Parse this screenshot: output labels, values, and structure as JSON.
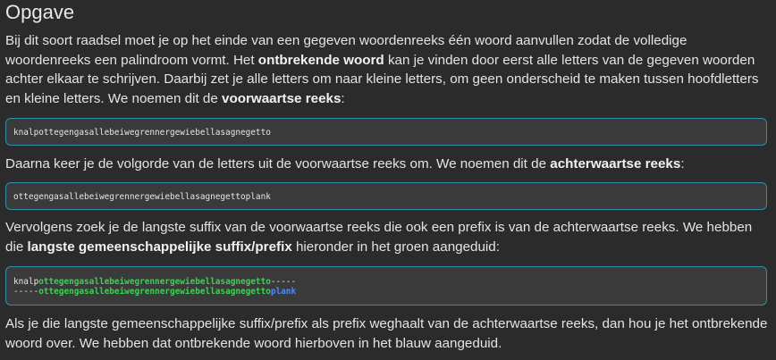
{
  "heading": "Opgave",
  "p1": {
    "t1": "Bij dit soort raadsel moet je op het einde van een gegeven woordenreeks één woord aanvullen zodat de volledige woordenreeks een palindroom vormt. Het ",
    "b1": "ontbrekende woord",
    "t2": " kan je vinden door eerst alle letters van de gegeven woorden achter elkaar te schrijven. Daarbij zet je alle letters om naar kleine letters, om geen onderscheid te maken tussen hoofdletters en kleine letters. We noemen dit de ",
    "b2": "voorwaartse reeks",
    "t3": ":"
  },
  "code1": "knalpottegengasallebeiwegrennergewiebellasagnegetto",
  "p2": {
    "t1": "Daarna keer je de volgorde van de letters uit de voorwaartse reeks om. We noemen dit de ",
    "b1": "achterwaartse reeks",
    "t2": ":"
  },
  "code2": "ottegengasallebeiwegrennergewiebellasagnegettoplank",
  "p3": {
    "t1": "Vervolgens zoek je de langste suffix van de voorwaartse reeks die ook een prefix is van de achterwaartse reeks. We hebben die ",
    "b1": "langste gemeenschappelijke suffix/prefix",
    "t2": " hieronder in het groen aangeduid:"
  },
  "code3": {
    "line1_prefix": "knalp",
    "line1_green": "ottegengasallebeiwegrennergewiebellasagnegetto",
    "line1_suffix": "-----",
    "line2_prefix": "-----",
    "line2_green": "ottegengasallebeiwegrennergewiebellasagnegetto",
    "line2_blue": "plank",
    "colors": {
      "green": "#39d353",
      "blue": "#4a8cff",
      "border": "#2f8fa3"
    }
  },
  "p4": {
    "t1": "Als je die langste gemeenschappelijke suffix/prefix als prefix weghaalt van de achterwaartse reeks, dan hou je het ontbrekende woord over. We hebben dat ontbrekende woord hierboven in het blauw aangeduid."
  }
}
